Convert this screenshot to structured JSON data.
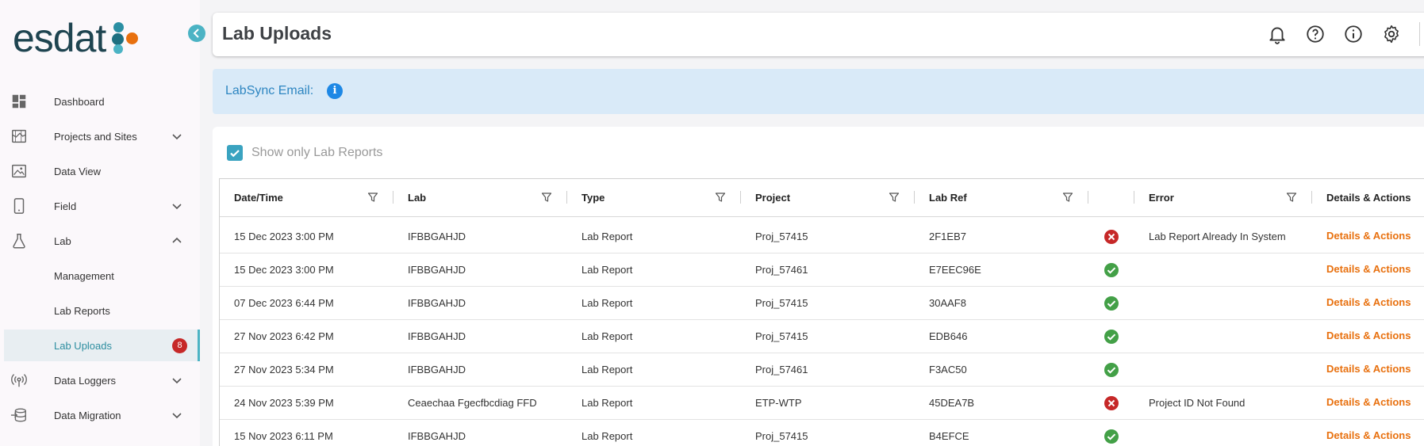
{
  "brand": {
    "name": "esdat",
    "colors": {
      "primary": "#1e4450",
      "accent": "#4bb3c4",
      "orange": "#e8700e"
    }
  },
  "sidebar": {
    "collapse_icon": "chevron-left-icon",
    "items": [
      {
        "label": "Dashboard",
        "icon": "dashboard-icon",
        "expandable": false
      },
      {
        "label": "Projects and Sites",
        "icon": "map-icon",
        "expandable": true,
        "expanded": false
      },
      {
        "label": "Data View",
        "icon": "image-view-icon",
        "expandable": false
      },
      {
        "label": "Field",
        "icon": "mobile-icon",
        "expandable": true,
        "expanded": false
      },
      {
        "label": "Lab",
        "icon": "flask-icon",
        "expandable": true,
        "expanded": true
      },
      {
        "label": "Management",
        "sub": true
      },
      {
        "label": "Lab Reports",
        "sub": true
      },
      {
        "label": "Lab Uploads",
        "sub": true,
        "active": true,
        "badge": "8"
      },
      {
        "label": "Data Loggers",
        "icon": "broadcast-icon",
        "expandable": true,
        "expanded": false
      },
      {
        "label": "Data Migration",
        "icon": "database-import-icon",
        "expandable": true,
        "expanded": false
      }
    ]
  },
  "header": {
    "title": "Lab Uploads",
    "icons": [
      "bell-icon",
      "help-icon",
      "info-icon",
      "gear-icon"
    ]
  },
  "email_banner": {
    "label": "LabSync Email:",
    "info_icon": "i"
  },
  "filter": {
    "show_only_label": "Show only Lab Reports",
    "checked": true
  },
  "table": {
    "columns": [
      "Date/Time",
      "Lab",
      "Type",
      "Project",
      "Lab Ref",
      "",
      "Error",
      "Details & Actions"
    ],
    "rows": [
      {
        "datetime": "15 Dec 2023 3:00 PM",
        "lab": "IFBBGAHJD",
        "type": "Lab Report",
        "project": "Proj_57415",
        "labref": "2F1EB7",
        "status": "error",
        "error": "Lab Report Already In System",
        "action": "Details & Actions"
      },
      {
        "datetime": "15 Dec 2023 3:00 PM",
        "lab": "IFBBGAHJD",
        "type": "Lab Report",
        "project": "Proj_57461",
        "labref": "E7EEC96E",
        "status": "success",
        "error": "",
        "action": "Details & Actions"
      },
      {
        "datetime": "07 Dec 2023 6:44 PM",
        "lab": "IFBBGAHJD",
        "type": "Lab Report",
        "project": "Proj_57415",
        "labref": "30AAF8",
        "status": "success",
        "error": "",
        "action": "Details & Actions"
      },
      {
        "datetime": "27 Nov 2023 6:42 PM",
        "lab": "IFBBGAHJD",
        "type": "Lab Report",
        "project": "Proj_57415",
        "labref": "EDB646",
        "status": "success",
        "error": "",
        "action": "Details & Actions"
      },
      {
        "datetime": "27 Nov 2023 5:34 PM",
        "lab": "IFBBGAHJD",
        "type": "Lab Report",
        "project": "Proj_57461",
        "labref": "F3AC50",
        "status": "success",
        "error": "",
        "action": "Details & Actions"
      },
      {
        "datetime": "24 Nov 2023 5:39 PM",
        "lab": "Ceaechaa Fgecfbcdiag FFD",
        "type": "Lab Report",
        "project": "ETP-WTP",
        "labref": "45DEA7B",
        "status": "error",
        "error": "Project ID Not Found",
        "action": "Details & Actions"
      },
      {
        "datetime": "15 Nov 2023 6:11 PM",
        "lab": "IFBBGAHJD",
        "type": "Lab Report",
        "project": "Proj_57415",
        "labref": "B4EFCE",
        "status": "success",
        "error": "",
        "action": "Details & Actions"
      }
    ]
  }
}
